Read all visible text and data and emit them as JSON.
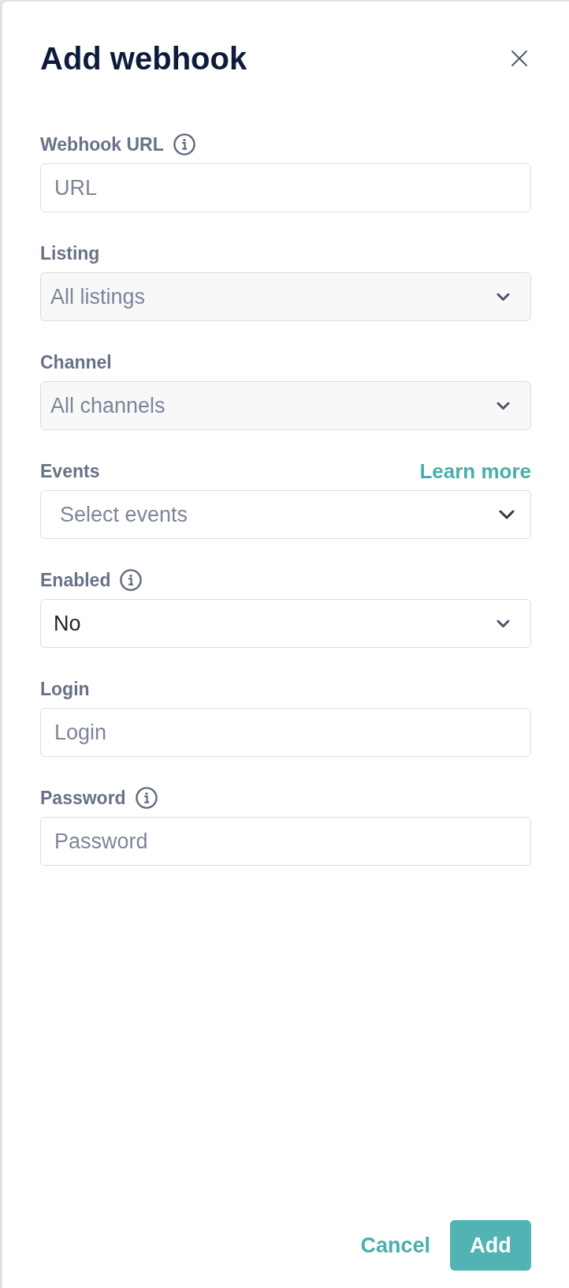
{
  "dialog": {
    "title": "Add webhook"
  },
  "fields": [
    {
      "kind": "text",
      "label": "Webhook URL",
      "info": true,
      "disabled": false,
      "placeholder": "URL"
    },
    {
      "kind": "select",
      "label": "Listing",
      "info": false,
      "disabled": true,
      "value": "All listings"
    },
    {
      "kind": "select",
      "label": "Channel",
      "info": false,
      "disabled": true,
      "value": "All channels"
    },
    {
      "kind": "multiselect",
      "label": "Events",
      "info": false,
      "disabled": false,
      "link": "Learn more",
      "placeholder": "Select events"
    },
    {
      "kind": "select",
      "label": "Enabled",
      "info": true,
      "disabled": false,
      "value": "No"
    },
    {
      "kind": "text",
      "label": "Login",
      "info": false,
      "disabled": false,
      "placeholder": "Login"
    },
    {
      "kind": "password",
      "label": "Password",
      "info": true,
      "disabled": false,
      "placeholder": "Password"
    }
  ],
  "buttons": [
    {
      "kind": "text",
      "label": "Cancel"
    },
    {
      "kind": "primary",
      "label": "Add"
    }
  ]
}
